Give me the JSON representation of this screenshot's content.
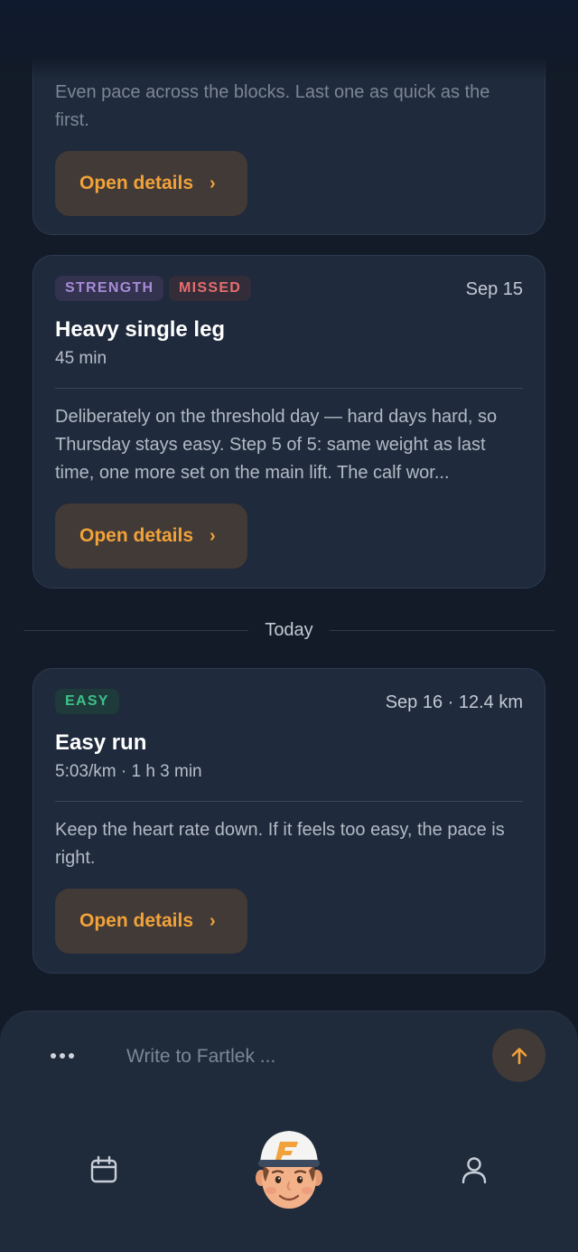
{
  "cards": [
    {
      "description": "Even pace across the blocks. Last one as quick as the first.",
      "button_label": "Open details"
    },
    {
      "tags": [
        "STRENGTH",
        "MISSED"
      ],
      "date": "Sep 15",
      "title": "Heavy single leg",
      "subtitle": "45 min",
      "description": "Deliberately on the threshold day — hard days hard, so Thursday stays easy. Step 5 of 5: same weight as last time, one more set on the main lift. The calf wor...",
      "button_label": "Open details"
    },
    {
      "tags": [
        "EASY"
      ],
      "date": "Sep 16 · 12.4 km",
      "title": "Easy run",
      "subtitle": "5:03/km · 1 h 3 min",
      "description": "Keep the heart rate down. If it feels too easy, the pace is right.",
      "button_label": "Open details"
    }
  ],
  "separator": {
    "label": "Today"
  },
  "composer": {
    "placeholder": "Write to Fartlek ...",
    "value": ""
  },
  "icons": {
    "more": "more-dots-icon",
    "send": "arrow-up-icon",
    "calendar": "calendar-icon",
    "avatar": "coach-avatar",
    "profile": "user-icon"
  },
  "colors": {
    "background": "#131b28",
    "card": "#1f2a3c",
    "accent": "#f2a23a",
    "strength": "#a78bd8",
    "missed": "#e56e6e",
    "easy": "#3ec08a"
  }
}
